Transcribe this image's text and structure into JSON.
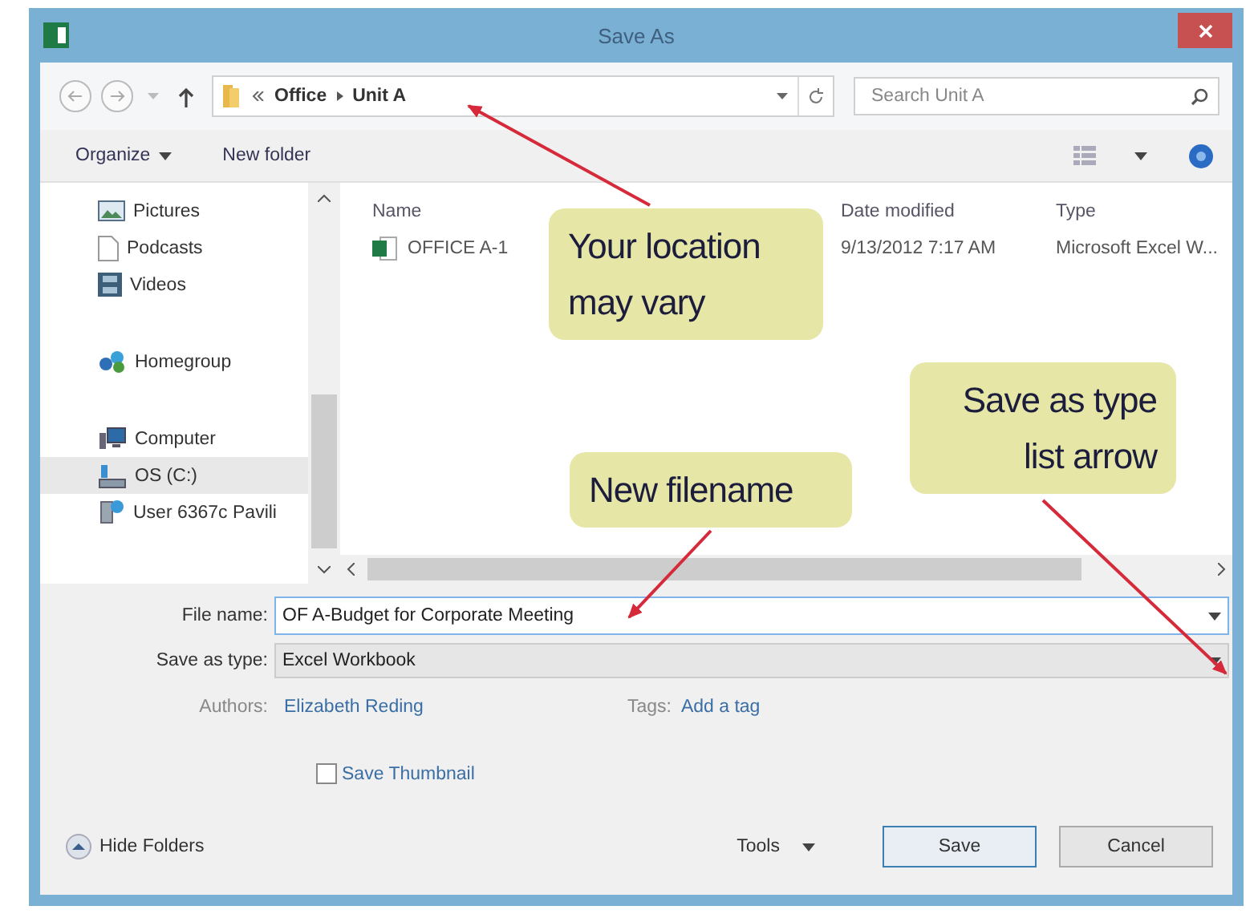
{
  "window": {
    "title": "Save As"
  },
  "address_bar": {
    "path": [
      "Office",
      "Unit A"
    ],
    "search": {
      "placeholder": "Search Unit A"
    }
  },
  "toolbar": {
    "buttons": [
      {
        "label": "Organize",
        "menu": true
      },
      {
        "label": "New folder",
        "menu": false
      }
    ]
  },
  "navigation": {
    "sections": [
      {
        "items": [
          {
            "label": "Pictures",
            "kind": "pictures",
            "selected": false
          },
          {
            "label": "Podcasts",
            "kind": "document",
            "selected": false
          },
          {
            "label": "Videos",
            "kind": "videos",
            "selected": false
          }
        ]
      },
      {
        "items": [
          {
            "label": "Homegroup",
            "kind": "homegroup",
            "selected": false
          }
        ]
      },
      {
        "items": [
          {
            "label": "Computer",
            "kind": "computer",
            "selected": false
          },
          {
            "label": "OS (C:)",
            "kind": "drive",
            "selected": true
          },
          {
            "label": "User 6367c Pavili",
            "kind": "network-drive",
            "selected": false
          }
        ]
      }
    ]
  },
  "file_list": {
    "columns": [
      "Name",
      "Date modified",
      "Type"
    ],
    "rows": [
      {
        "name": "OFFICE A-1",
        "date_modified": "9/13/2012 7:17 AM",
        "type": "Microsoft Excel W..."
      }
    ]
  },
  "form": {
    "file_name": {
      "label": "File name:",
      "value": "OF A-Budget for Corporate Meeting"
    },
    "save_as_type": {
      "label": "Save as type:",
      "value": "Excel Workbook"
    },
    "authors": {
      "label": "Authors:",
      "value": "Elizabeth Reding"
    },
    "tags": {
      "label": "Tags:",
      "value": "Add a tag"
    },
    "save_thumbnail": {
      "label": "Save Thumbnail",
      "checked": false
    }
  },
  "footer": {
    "hide_folders": "Hide Folders",
    "tools": "Tools",
    "buttons": [
      {
        "label": "Save",
        "default": true
      },
      {
        "label": "Cancel",
        "default": false
      }
    ]
  },
  "callouts": [
    {
      "text": "Your location\nmay vary"
    },
    {
      "text": "New filename"
    },
    {
      "text": "Save as type\nlist arrow"
    }
  ]
}
